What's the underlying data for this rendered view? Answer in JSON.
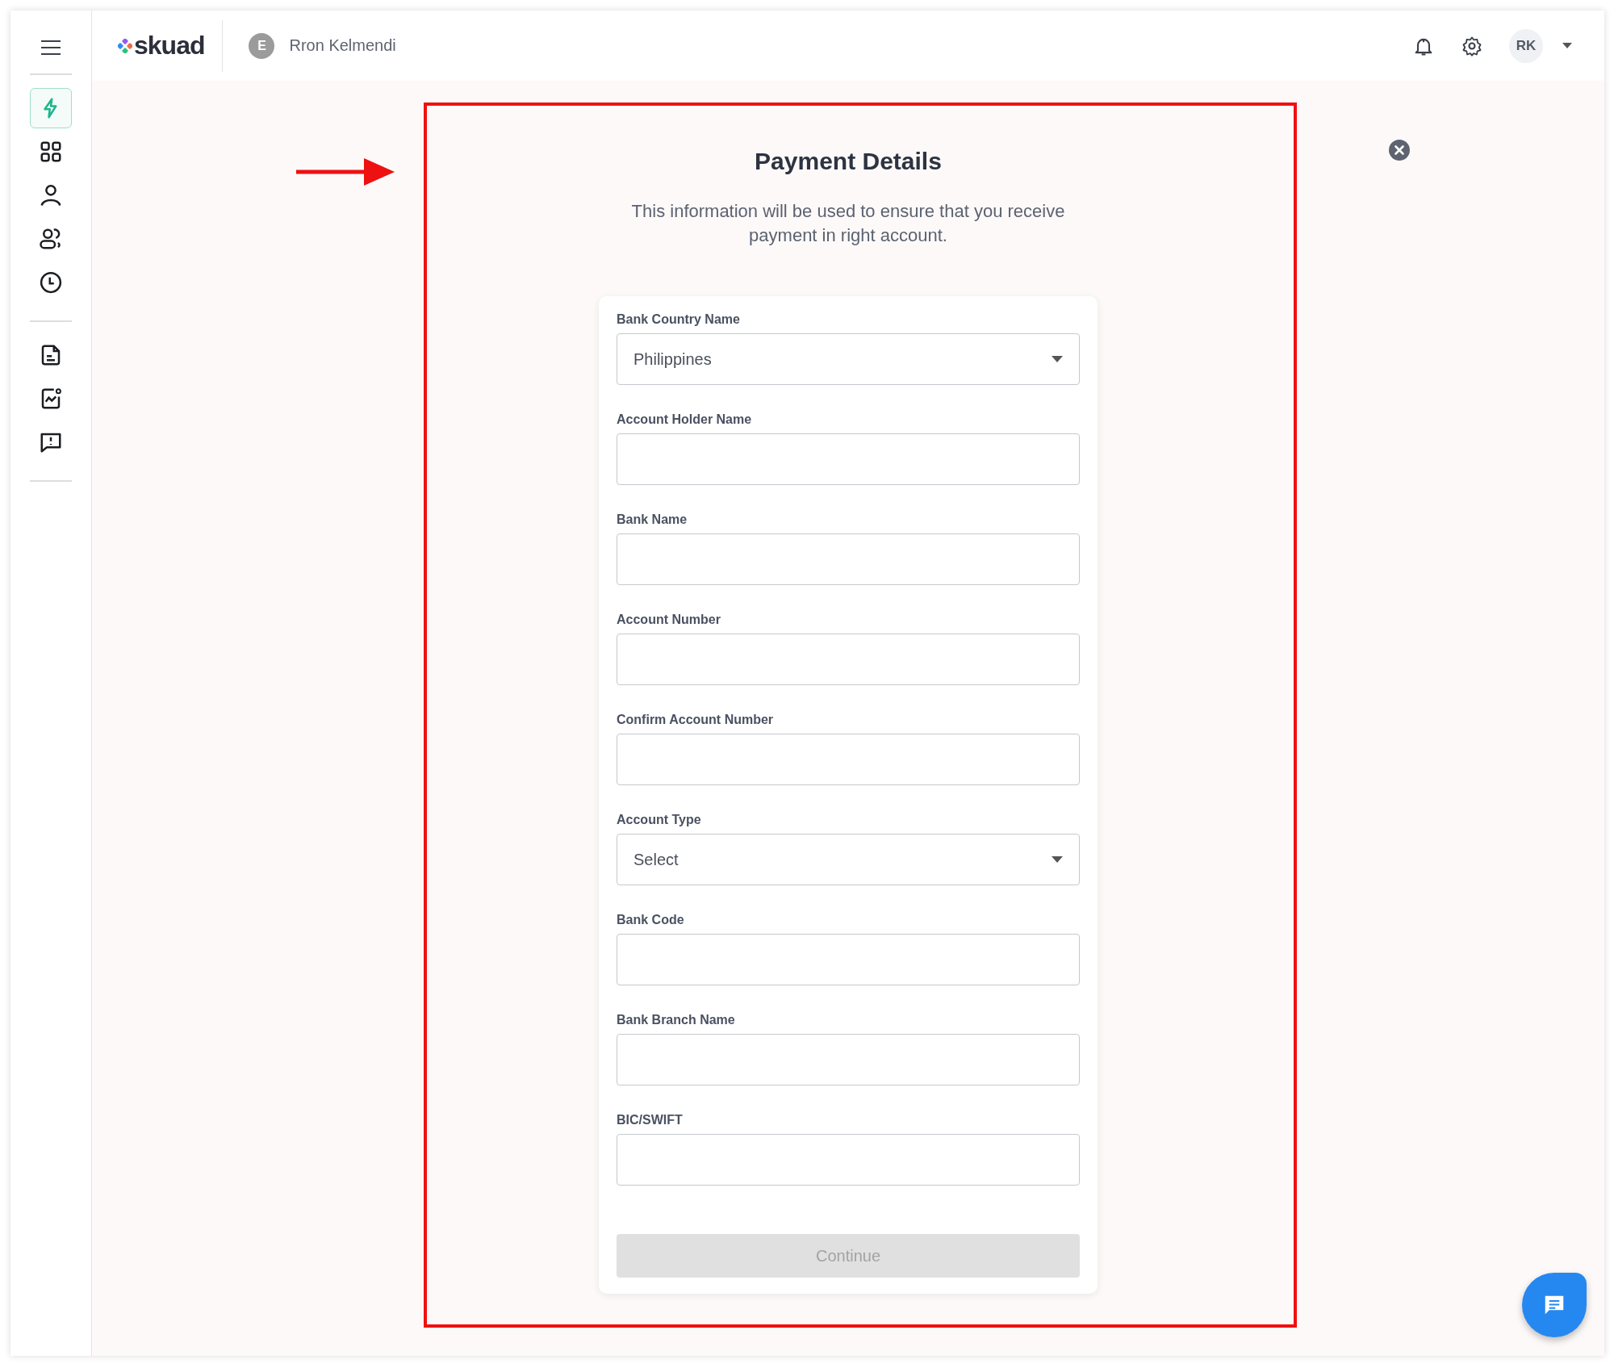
{
  "sidebar": {
    "groups": [
      [
        {
          "kind": "bolt",
          "selected": true
        },
        {
          "kind": "grid",
          "selected": false
        },
        {
          "kind": "person",
          "selected": false
        },
        {
          "kind": "people",
          "selected": false
        },
        {
          "kind": "clock",
          "selected": false
        }
      ],
      [
        {
          "kind": "document",
          "selected": false
        },
        {
          "kind": "chart",
          "selected": false
        },
        {
          "kind": "message",
          "selected": false
        }
      ]
    ]
  },
  "header": {
    "logo": "skuad",
    "account_initial": "E",
    "account_name": "Rron Kelmendi",
    "user_initials": "RK"
  },
  "dialog": {
    "title": "Payment Details",
    "subtitle": "This information will be used to ensure that you receive payment in right account.",
    "fields": [
      {
        "kind": "select",
        "label": "Bank Country Name",
        "value": "Philippines"
      },
      {
        "kind": "text",
        "label": "Account Holder Name"
      },
      {
        "kind": "text",
        "label": "Bank Name"
      },
      {
        "kind": "text",
        "label": "Account Number"
      },
      {
        "kind": "text",
        "label": "Confirm Account Number"
      },
      {
        "kind": "select",
        "label": "Account Type",
        "value": "Select"
      },
      {
        "kind": "text",
        "label": "Bank Code"
      },
      {
        "kind": "text",
        "label": "Bank Branch Name"
      },
      {
        "kind": "text",
        "label": "BIC/SWIFT"
      }
    ],
    "button": {
      "label": "Continue",
      "disabled": true
    }
  }
}
